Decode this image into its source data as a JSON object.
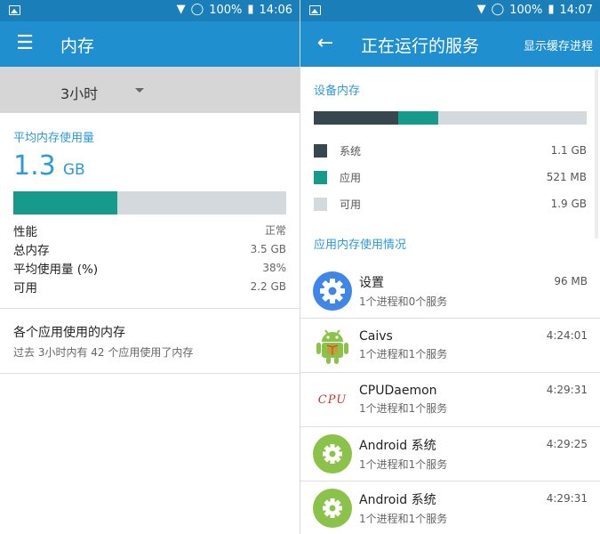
{
  "colors": {
    "accent": "#2d9ad9",
    "system": "#37474f",
    "apps": "#159a8c",
    "free": "#d3d9dd",
    "appbar": "#1f8fd0"
  },
  "left": {
    "status": {
      "battery": "100%",
      "time": "14:06"
    },
    "title": "内存",
    "period": "3小时",
    "avg_label": "平均内存使用量",
    "avg_value": "1.3",
    "avg_unit": "GB",
    "usage_fraction": 0.38,
    "stats": [
      {
        "label": "性能",
        "value": "正常"
      },
      {
        "label": "总内存",
        "value": "3.5 GB"
      },
      {
        "label": "平均使用量 (%)",
        "value": "38%"
      },
      {
        "label": "可用",
        "value": "2.2 GB"
      }
    ],
    "apps_title": "各个应用使用的内存",
    "apps_subtitle": "过去 3小时内有 42 个应用使用了内存"
  },
  "right": {
    "status": {
      "battery": "100%",
      "time": "14:07"
    },
    "title": "正在运行的服务",
    "action": "显示缓存进程",
    "device_label": "设备内存",
    "bar": {
      "system": 0.31,
      "apps": 0.145,
      "free": 0.545
    },
    "legend": [
      {
        "label": "系统",
        "value": "1.1 GB",
        "color": "#37474f"
      },
      {
        "label": "应用",
        "value": "521 MB",
        "color": "#159a8c"
      },
      {
        "label": "可用",
        "value": "1.9 GB",
        "color": "#d3d9dd"
      }
    ],
    "apps_label": "应用内存使用情况",
    "apps": [
      {
        "name": "设置",
        "sub": "1个进程和0个服务",
        "value": "96 MB",
        "icon": "settings-icon"
      },
      {
        "name": "Caivs",
        "sub": "1个进程和1个服务",
        "value": "4:24:01",
        "icon": "android-icon"
      },
      {
        "name": "CPUDaemon",
        "sub": "1个进程和1个服务",
        "value": "4:29:31",
        "icon": "cpu-logo-icon",
        "icon_text": "CPU"
      },
      {
        "name": "Android 系统",
        "sub": "1个进程和1个服务",
        "value": "4:29:25",
        "icon": "android-system-icon"
      },
      {
        "name": "Android 系统",
        "sub": "1个进程和1个服务",
        "value": "4:29:31",
        "icon": "android-system-icon"
      }
    ]
  }
}
